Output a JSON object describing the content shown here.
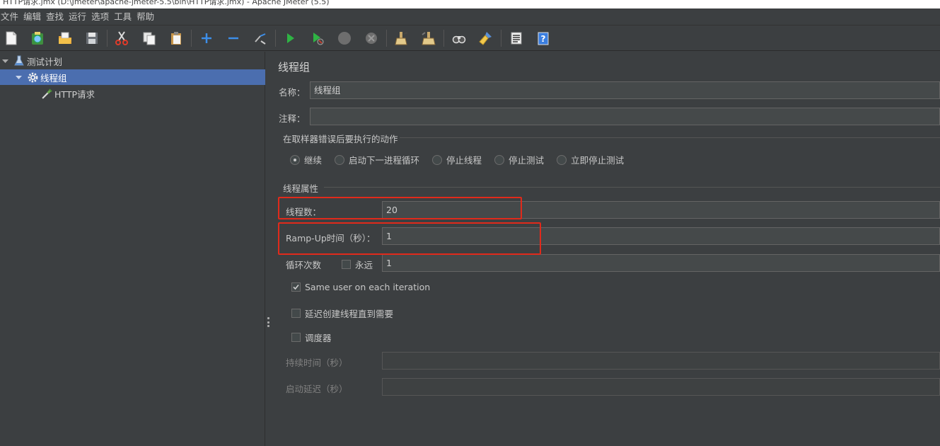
{
  "window": {
    "title": "HTTP请求.jmx (D:\\Jmeter\\apache-jmeter-5.5\\bin\\HTTP请求.jmx) - Apache JMeter (5.5)"
  },
  "menu": [
    "文件",
    "编辑",
    "查找",
    "运行",
    "选项",
    "工具",
    "帮助"
  ],
  "toolbar": {
    "icons": [
      "new-icon",
      "templates-icon",
      "open-icon",
      "save-icon",
      "cut-icon",
      "copy-icon",
      "paste-icon",
      "expand-icon",
      "collapse-icon",
      "toggle-icon",
      "start-icon",
      "start-no-pause-icon",
      "stop-icon",
      "shutdown-icon",
      "clear-icon",
      "clear-all-icon",
      "search-icon",
      "reset-search-icon",
      "function-helper-icon",
      "help-icon"
    ]
  },
  "tree": {
    "items": [
      {
        "label": "测试计划",
        "icon": "test-plan-icon",
        "level": 0,
        "selected": false
      },
      {
        "label": "线程组",
        "icon": "gear-icon",
        "level": 1,
        "selected": true
      },
      {
        "label": "HTTP请求",
        "icon": "pipette-icon",
        "level": 2,
        "selected": false
      }
    ]
  },
  "panel": {
    "title": "线程组",
    "name_label": "名称：",
    "name_value": "线程组",
    "comment_label": "注释：",
    "comment_value": "",
    "on_error": {
      "title": "在取样器错误后要执行的动作",
      "options": [
        "继续",
        "启动下一进程循环",
        "停止线程",
        "停止测试",
        "立即停止测试"
      ],
      "selected": "继续"
    },
    "thread_props": {
      "title": "线程属性",
      "threads_label": "线程数：",
      "threads_value": "20",
      "rampup_label": "Ramp-Up时间（秒）：",
      "rampup_value": "1",
      "loop_label": "循环次数",
      "forever_label": "永远",
      "forever_checked": false,
      "loop_value": "1",
      "same_user_label": "Same user on each iteration",
      "same_user_checked": true,
      "delay_label": "延迟创建线程直到需要",
      "delay_checked": false,
      "scheduler_label": "调度器",
      "scheduler_checked": false,
      "duration_label": "持续时间（秒）",
      "duration_value": "",
      "startup_delay_label": "启动延迟（秒）",
      "startup_delay_value": ""
    }
  },
  "colors": {
    "background": "#3c3f41",
    "selection": "#4b6eaf",
    "highlight": "#e12a1b"
  }
}
